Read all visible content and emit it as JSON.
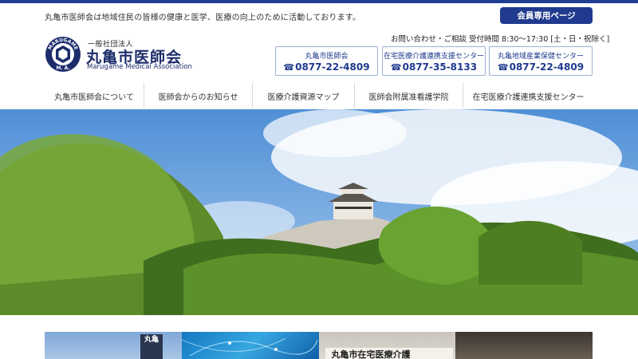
{
  "header": {
    "tagline": "丸亀市医師会は地域住民の皆様の健康と医学、医療の向上のために活動しております。",
    "member_button": "会員専用ページ",
    "logo": {
      "small_text": "一般社団法人",
      "name": "丸亀市医師会",
      "english": "Marugame Medical Association",
      "emblem_text": "MARUGAME",
      "emblem_letters": "M. A."
    },
    "hours": "お問い合わせ・ご相談 受付時間 8:30〜17:30 [土・日・祝除く]",
    "contacts": [
      {
        "name": "丸亀市医師会",
        "tel": "0877-22-4809"
      },
      {
        "name": "在宅医療介護連携支援センター",
        "tel": "0877-35-8133"
      },
      {
        "name": "丸亀地域産業保健センター",
        "tel": "0877-22-4809"
      }
    ]
  },
  "nav": {
    "items": [
      {
        "label": "丸亀市医師会について"
      },
      {
        "label": "医師会からのお知らせ"
      },
      {
        "label": "医療介護資源マップ"
      },
      {
        "label": "医師会附属准看護学院"
      },
      {
        "label": "在宅医療介護連携支援センター"
      }
    ]
  },
  "tiles": {
    "sign_text": "丸亀",
    "board_text": "丸亀市在宅医療介護"
  },
  "colors": {
    "brand": "#1f3a8e",
    "top_line": "#1f3f93",
    "contact_border": "#9fb0d6"
  }
}
